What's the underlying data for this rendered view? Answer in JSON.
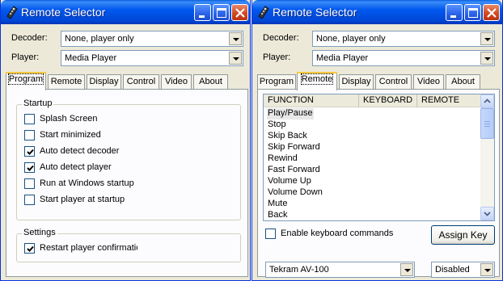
{
  "windows": [
    {
      "title": "Remote Selector",
      "decoder_label": "Decoder:",
      "decoder_value": "None, player only",
      "player_label": "Player:",
      "player_value": "Media Player",
      "tabs": [
        "Program",
        "Remote",
        "Display",
        "Control",
        "Video",
        "About"
      ],
      "active_tab": "Program",
      "startup": {
        "title": "Startup",
        "options": [
          {
            "label": "Splash Screen",
            "checked": false
          },
          {
            "label": "Start minimized",
            "checked": false
          },
          {
            "label": "Auto detect decoder",
            "checked": true
          },
          {
            "label": "Auto detect player",
            "checked": true
          },
          {
            "label": "Run at Windows startup",
            "checked": false
          },
          {
            "label": "Start player at startup",
            "checked": false
          }
        ]
      },
      "settings": {
        "title": "Settings",
        "options": [
          {
            "label": "Restart player confirmation",
            "checked": true
          }
        ]
      }
    },
    {
      "title": "Remote Selector",
      "decoder_label": "Decoder:",
      "decoder_value": "None, player only",
      "player_label": "Player:",
      "player_value": "Media Player",
      "tabs": [
        "Program",
        "Remote",
        "Display",
        "Control",
        "Video",
        "About"
      ],
      "active_tab": "Remote",
      "list": {
        "columns": [
          "FUNCTION",
          "KEYBOARD",
          "REMOTE"
        ],
        "items": [
          "Play/Pause",
          "Stop",
          "Skip Back",
          "Skip Forward",
          "Rewind",
          "Fast Forward",
          "Volume Up",
          "Volume Down",
          "Mute",
          "Back"
        ],
        "selected": "Play/Pause"
      },
      "enable_keyboard": {
        "label": "Enable keyboard commands",
        "checked": false
      },
      "assign_key_label": "Assign Key",
      "remote_value": "Tekram AV-100",
      "mode_value": "Disabled"
    }
  ],
  "colors": {
    "titlebar": "#0058ee",
    "close_button": "#d24a22",
    "tab_highlight": "#ffc83c",
    "dialog_bg": "#ece9d8"
  }
}
